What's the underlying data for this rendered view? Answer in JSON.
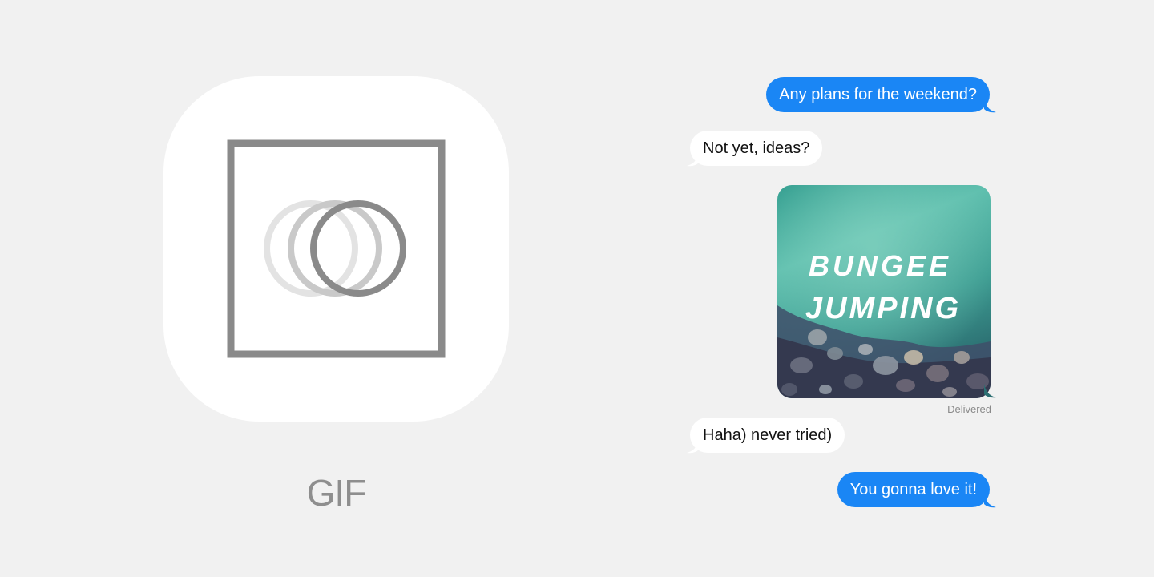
{
  "app": {
    "name": "GIF"
  },
  "conversation": {
    "messages": [
      {
        "direction": "outgoing",
        "text": "Any plans for the weekend?"
      },
      {
        "direction": "incoming",
        "text": "Not yet, ideas?"
      },
      {
        "direction": "outgoing",
        "type": "image",
        "image_text": [
          "BUNGEE",
          "JUMPING"
        ]
      },
      {
        "direction": "incoming",
        "text": "Haha) never tried)"
      },
      {
        "direction": "outgoing",
        "text": "You gonna love it!"
      }
    ],
    "status": "Delivered"
  },
  "colors": {
    "background": "#f1f1f1",
    "outgoing_bubble": "#1a86f5",
    "incoming_bubble": "#ffffff",
    "icon_stroke": "#8a8a8a"
  },
  "icons": [
    "gif-app-icon",
    "frame-icon",
    "overlapping-rings-icon"
  ]
}
